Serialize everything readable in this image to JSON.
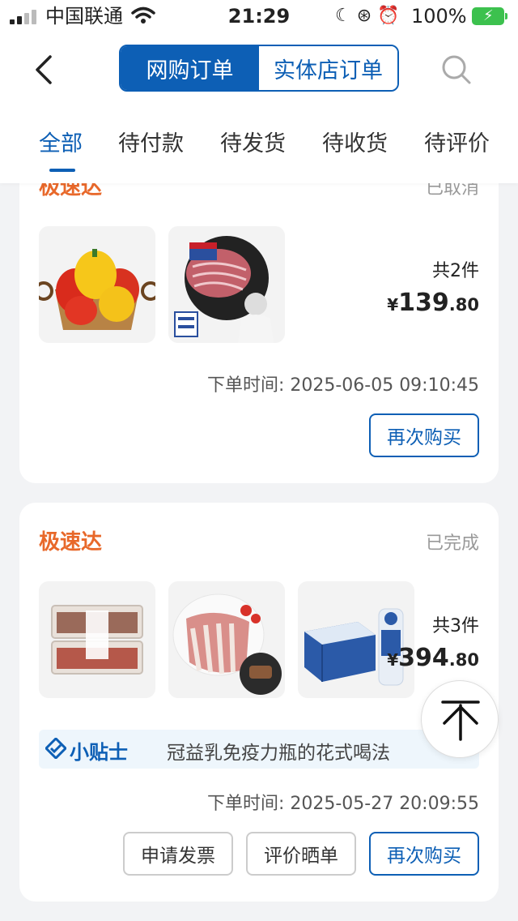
{
  "status_bar": {
    "carrier": "中国联通",
    "time": "21:29",
    "battery": "100%"
  },
  "header": {
    "segment": [
      {
        "label": "网购订单",
        "active": true
      },
      {
        "label": "实体店订单",
        "active": false
      }
    ],
    "tabs": [
      "全部",
      "待付款",
      "待发货",
      "待收货",
      "待评价"
    ],
    "active_tab": "全部"
  },
  "orders": [
    {
      "store": "极速达",
      "status": "已取消",
      "products": [
        {
          "name": "yellow-red-bell-peppers"
        },
        {
          "name": "usda-choice-beef-slices",
          "badges": [
            "USDA",
            "CHOICE",
            "大董推荐"
          ]
        }
      ],
      "quantity": "共2件",
      "price": {
        "currency": "¥",
        "integer": "139",
        "decimal": ".80"
      },
      "order_time": "下单时间: 2025-06-05 09:10:45",
      "buttons": [
        "再次购买"
      ]
    },
    {
      "store": "极速达",
      "status": "已完成",
      "products": [
        {
          "name": "packaged-meat-trays"
        },
        {
          "name": "lamb-chops"
        },
        {
          "name": "milk-box-and-bottle"
        }
      ],
      "quantity": "共3件",
      "price": {
        "currency": "¥",
        "integer": "394",
        "decimal": ".80"
      },
      "tip": {
        "label": "小贴士",
        "text": "冠益乳免疫力瓶的花式喝法"
      },
      "order_time": "下单时间: 2025-05-27 20:09:55",
      "buttons": [
        "申请发票",
        "评价晒单",
        "再次购买"
      ]
    }
  ],
  "colors": {
    "brand_blue": "#0d5fb5",
    "store_orange": "#e8682a",
    "background": "#f2f3f5"
  },
  "icons": [
    "back-arrow-icon",
    "search-icon",
    "back-to-top-icon",
    "tip-check-icon",
    "wifi-icon",
    "signal-icon",
    "battery-icon"
  ]
}
